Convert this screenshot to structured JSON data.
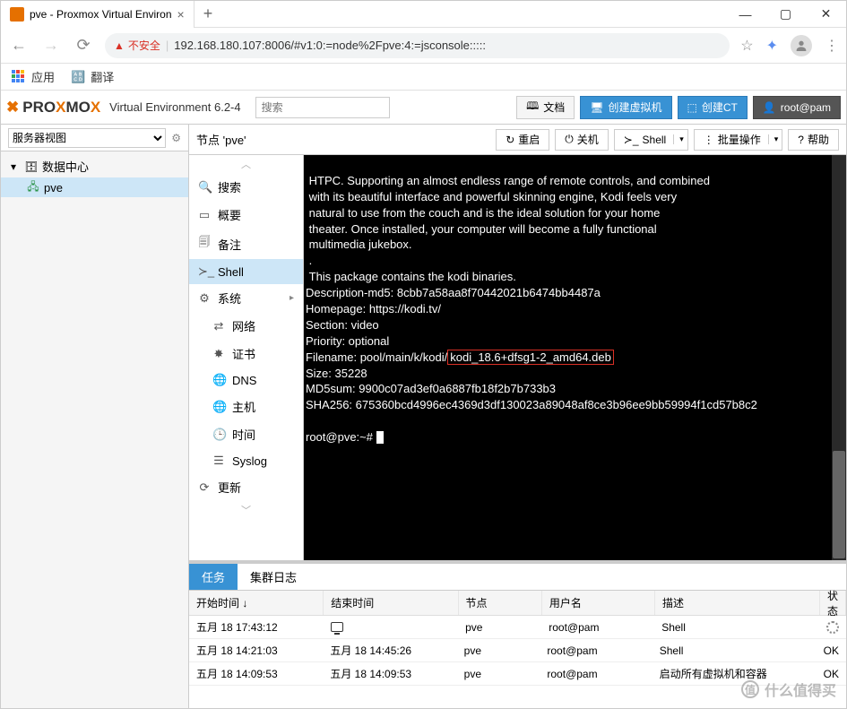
{
  "window": {
    "tab_title": "pve - Proxmox Virtual Environ",
    "url_warning": "不安全",
    "url": "192.168.180.107:8006/#v1:0:=node%2Fpve:4:=jsconsole:::::"
  },
  "bookmarks": {
    "apps": "应用",
    "translate": "翻译"
  },
  "header": {
    "brand1": "PRO",
    "brand2": "MO",
    "brand3": "X",
    "product": "Virtual Environment 6.2-4",
    "search_placeholder": "搜索",
    "docs": "文档",
    "create_vm": "创建虚拟机",
    "create_ct": "创建CT",
    "user": "root@pam"
  },
  "tree": {
    "view_label": "服务器视图",
    "datacenter": "数据中心",
    "node": "pve"
  },
  "node_panel": {
    "title": "节点 'pve'",
    "restart": "重启",
    "shutdown": "关机",
    "shell": "Shell",
    "bulk": "批量操作",
    "help": "帮助"
  },
  "submenu": {
    "search": "搜索",
    "summary": "概要",
    "notes": "备注",
    "shell": "Shell",
    "system": "系统",
    "network": "网络",
    "cert": "证书",
    "dns": "DNS",
    "host": "主机",
    "time": "时间",
    "syslog": "Syslog",
    "update": "更新"
  },
  "terminal": {
    "lines": [
      " HTPC. Supporting an almost endless range of remote controls, and combined",
      " with its beautiful interface and powerful skinning engine, Kodi feels very",
      " natural to use from the couch and is the ideal solution for your home",
      " theater. Once installed, your computer will become a fully functional",
      " multimedia jukebox.",
      " .",
      " This package contains the kodi binaries.",
      "Description-md5: 8cbb7a58aa8f70442021b6474bb4487a",
      "Homepage: https://kodi.tv/",
      "Section: video",
      "Priority: optional"
    ],
    "filename_prefix": "Filename: pool/main/k/kodi/",
    "filename_hl": "kodi_18.6+dfsg1-2_amd64.deb",
    "lines2": [
      "Size: 35228",
      "MD5sum: 9900c07ad3ef0a6887fb18f2b7b733b3",
      "SHA256: 675360bcd4996ec4369d3df130023a89048af8ce3b96ee9bb59994f1cd57b8c2",
      ""
    ],
    "prompt": "root@pve:~# "
  },
  "bottom": {
    "tab_tasks": "任务",
    "tab_cluster": "集群日志",
    "col_start": "开始时间 ↓",
    "col_end": "结束时间",
    "col_node": "节点",
    "col_user": "用户名",
    "col_desc": "描述",
    "col_status": "状态",
    "rows": [
      {
        "start": "五月 18 17:43:12",
        "end": "",
        "end_icon": true,
        "node": "pve",
        "user": "root@pam",
        "desc": "Shell",
        "status": "",
        "spinner": true
      },
      {
        "start": "五月 18 14:21:03",
        "end": "五月 18 14:45:26",
        "node": "pve",
        "user": "root@pam",
        "desc": "Shell",
        "status": "OK"
      },
      {
        "start": "五月 18 14:09:53",
        "end": "五月 18 14:09:53",
        "node": "pve",
        "user": "root@pam",
        "desc": "启动所有虚拟机和容器",
        "status": "OK"
      }
    ]
  },
  "watermark": "什么值得买"
}
